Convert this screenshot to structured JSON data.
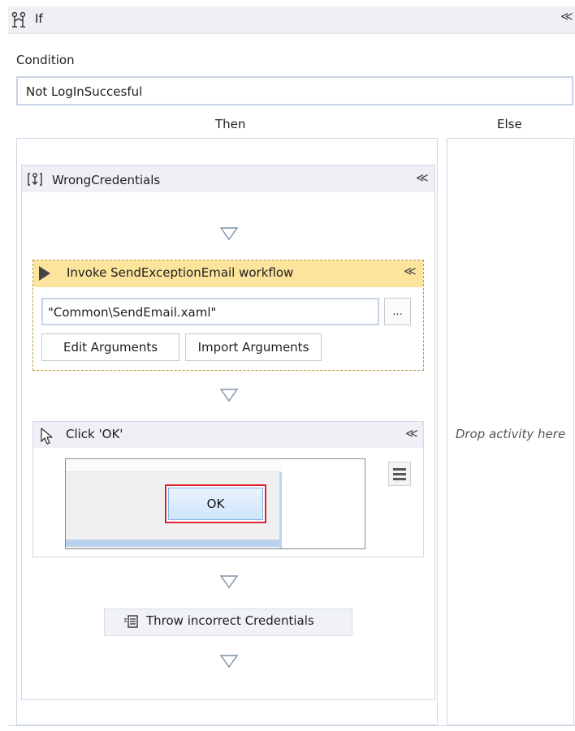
{
  "if_activity": {
    "title": "If",
    "collapse": "≪",
    "condition_label": "Condition",
    "condition_value": "Not LogInSuccesful",
    "then_label": "Then",
    "else_label": "Else",
    "else_drop_text": "Drop activity here"
  },
  "sequence": {
    "title": "WrongCredentials",
    "collapse": "≪"
  },
  "invoke": {
    "title": "Invoke SendExceptionEmail workflow",
    "collapse": "≪",
    "path_value": "\"Common\\SendEmail.xaml\"",
    "browse_label": "...",
    "edit_args_label": "Edit Arguments",
    "import_args_label": "Import Arguments"
  },
  "click": {
    "title": "Click 'OK'",
    "collapse": "≪",
    "screenshot_button_label": "OK"
  },
  "throw": {
    "title": "Throw incorrect Credentials"
  },
  "icons": {
    "if": "if-branch-icon",
    "sequence": "sequence-icon",
    "invoke": "play-icon",
    "click": "cursor-icon",
    "throw": "throw-icon",
    "menu": "hamburger-menu-icon",
    "arrow": "down-triangle-icon"
  },
  "colors": {
    "header_bg": "#eef0f5",
    "invoke_header_bg": "#fce49d",
    "invoke_border": "#b79a2c",
    "selection_outline": "#e0202c"
  }
}
